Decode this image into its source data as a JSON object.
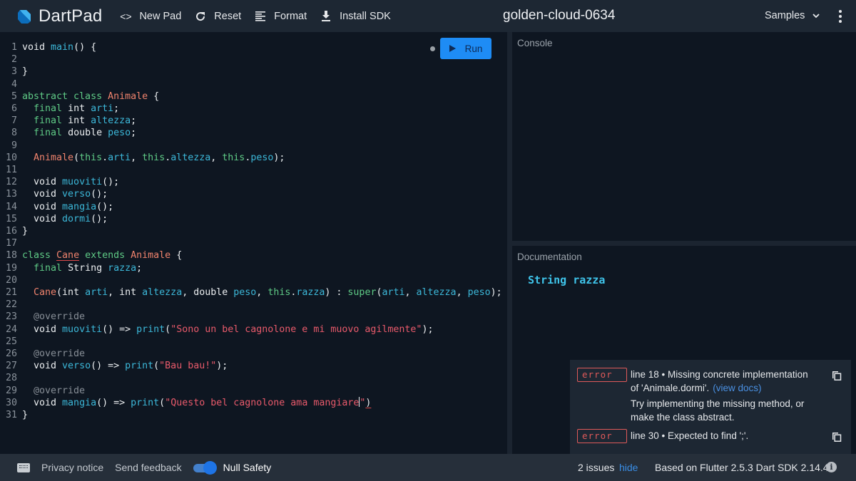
{
  "header": {
    "app_name": "DartPad",
    "buttons": [
      {
        "label": "New Pad",
        "icon": "code-icon"
      },
      {
        "label": "Reset",
        "icon": "refresh-icon"
      },
      {
        "label": "Format",
        "icon": "format-align-icon"
      },
      {
        "label": "Install SDK",
        "icon": "download-icon"
      }
    ],
    "pad_title": "golden-cloud-0634",
    "samples_label": "Samples"
  },
  "editor": {
    "run_label": "Run",
    "lines": [
      [
        [
          "kw-plain",
          "void "
        ],
        [
          "fn",
          "main"
        ],
        [
          "pl",
          "() {"
        ]
      ],
      [],
      [
        [
          "pl",
          "}"
        ]
      ],
      [],
      [
        [
          "kw",
          "abstract class "
        ],
        [
          "ty",
          "Animale"
        ],
        [
          "pl",
          " {"
        ]
      ],
      [
        [
          "pl",
          "  "
        ],
        [
          "kw",
          "final "
        ],
        [
          "pl",
          "int "
        ],
        [
          "fn",
          "arti"
        ],
        [
          "pl",
          ";"
        ]
      ],
      [
        [
          "pl",
          "  "
        ],
        [
          "kw",
          "final "
        ],
        [
          "pl",
          "int "
        ],
        [
          "fn",
          "altezza"
        ],
        [
          "pl",
          ";"
        ]
      ],
      [
        [
          "pl",
          "  "
        ],
        [
          "kw",
          "final "
        ],
        [
          "pl",
          "double "
        ],
        [
          "fn",
          "peso"
        ],
        [
          "pl",
          ";"
        ]
      ],
      [],
      [
        [
          "pl",
          "  "
        ],
        [
          "ty",
          "Animale"
        ],
        [
          "pl",
          "("
        ],
        [
          "kw",
          "this"
        ],
        [
          "pl",
          "."
        ],
        [
          "fn",
          "arti"
        ],
        [
          "pl",
          ", "
        ],
        [
          "kw",
          "this"
        ],
        [
          "pl",
          "."
        ],
        [
          "fn",
          "altezza"
        ],
        [
          "pl",
          ", "
        ],
        [
          "kw",
          "this"
        ],
        [
          "pl",
          "."
        ],
        [
          "fn",
          "peso"
        ],
        [
          "pl",
          ");"
        ]
      ],
      [],
      [
        [
          "pl",
          "  void "
        ],
        [
          "fn",
          "muoviti"
        ],
        [
          "pl",
          "();"
        ]
      ],
      [
        [
          "pl",
          "  void "
        ],
        [
          "fn",
          "verso"
        ],
        [
          "pl",
          "();"
        ]
      ],
      [
        [
          "pl",
          "  void "
        ],
        [
          "fn",
          "mangia"
        ],
        [
          "pl",
          "();"
        ]
      ],
      [
        [
          "pl",
          "  void "
        ],
        [
          "fn",
          "dormi"
        ],
        [
          "pl",
          "();"
        ]
      ],
      [
        [
          "pl",
          "}"
        ]
      ],
      [],
      [
        [
          "kw",
          "class "
        ],
        [
          "ty squig",
          "Cane"
        ],
        [
          "kw",
          " extends "
        ],
        [
          "ty",
          "Animale"
        ],
        [
          "pl",
          " {"
        ]
      ],
      [
        [
          "pl",
          "  "
        ],
        [
          "kw",
          "final "
        ],
        [
          "pl",
          "String "
        ],
        [
          "fn",
          "razza"
        ],
        [
          "pl",
          ";"
        ]
      ],
      [],
      [
        [
          "pl",
          "  "
        ],
        [
          "ty",
          "Cane"
        ],
        [
          "pl",
          "(int "
        ],
        [
          "fn",
          "arti"
        ],
        [
          "pl",
          ", int "
        ],
        [
          "fn",
          "altezza"
        ],
        [
          "pl",
          ", double "
        ],
        [
          "fn",
          "peso"
        ],
        [
          "pl",
          ", "
        ],
        [
          "kw",
          "this"
        ],
        [
          "pl",
          "."
        ],
        [
          "fn",
          "razza"
        ],
        [
          "pl",
          ") : "
        ],
        [
          "kw",
          "super"
        ],
        [
          "pl",
          "("
        ],
        [
          "fn",
          "arti"
        ],
        [
          "pl",
          ", "
        ],
        [
          "fn",
          "altezza"
        ],
        [
          "pl",
          ", "
        ],
        [
          "fn",
          "peso"
        ],
        [
          "pl",
          ");"
        ]
      ],
      [],
      [
        [
          "pl",
          "  "
        ],
        [
          "an",
          "@override"
        ]
      ],
      [
        [
          "pl",
          "  void "
        ],
        [
          "fn",
          "muoviti"
        ],
        [
          "pl",
          "() => "
        ],
        [
          "fn",
          "print"
        ],
        [
          "pl",
          "("
        ],
        [
          "st",
          "\"Sono un bel cagnolone e mi muovo agilmente\""
        ],
        [
          "pl",
          ");"
        ]
      ],
      [],
      [
        [
          "pl",
          "  "
        ],
        [
          "an",
          "@override"
        ]
      ],
      [
        [
          "pl",
          "  void "
        ],
        [
          "fn",
          "verso"
        ],
        [
          "pl",
          "() => "
        ],
        [
          "fn",
          "print"
        ],
        [
          "pl",
          "("
        ],
        [
          "st",
          "\"Bau bau!\""
        ],
        [
          "pl",
          ");"
        ]
      ],
      [],
      [
        [
          "pl",
          "  "
        ],
        [
          "an",
          "@override"
        ]
      ],
      [
        [
          "pl",
          "  void "
        ],
        [
          "fn",
          "mangia"
        ],
        [
          "pl",
          "() => "
        ],
        [
          "fn",
          "print"
        ],
        [
          "pl",
          "("
        ],
        [
          "st",
          "\"Questo bel cagnolone ama mangiare"
        ],
        [
          "cursor",
          ""
        ],
        [
          "st",
          "\""
        ],
        [
          "pl squig",
          ")"
        ]
      ],
      [
        [
          "pl",
          "}"
        ]
      ]
    ]
  },
  "console": {
    "label": "Console"
  },
  "documentation": {
    "label": "Documentation",
    "signature": "String razza"
  },
  "issues": [
    {
      "severity": "error",
      "message": "line 18 • Missing concrete implementation of 'Animale.dormi'.",
      "link": "(view docs)",
      "correction": "Try implementing the missing method, or make the class abstract."
    },
    {
      "severity": "error",
      "message": "line 30 • Expected to find ';'.",
      "link": "",
      "correction": ""
    }
  ],
  "footer": {
    "privacy": "Privacy notice",
    "feedback": "Send feedback",
    "null_safety_label": "Null Safety",
    "null_safety_enabled": true,
    "issues_count": "2 issues",
    "hide_label": "hide",
    "sdk_info": "Based on Flutter 2.5.3 Dart SDK 2.14.4"
  },
  "colors": {
    "accent": "#1e8cf5",
    "error": "#e05a5a",
    "link": "#4a90e2"
  }
}
